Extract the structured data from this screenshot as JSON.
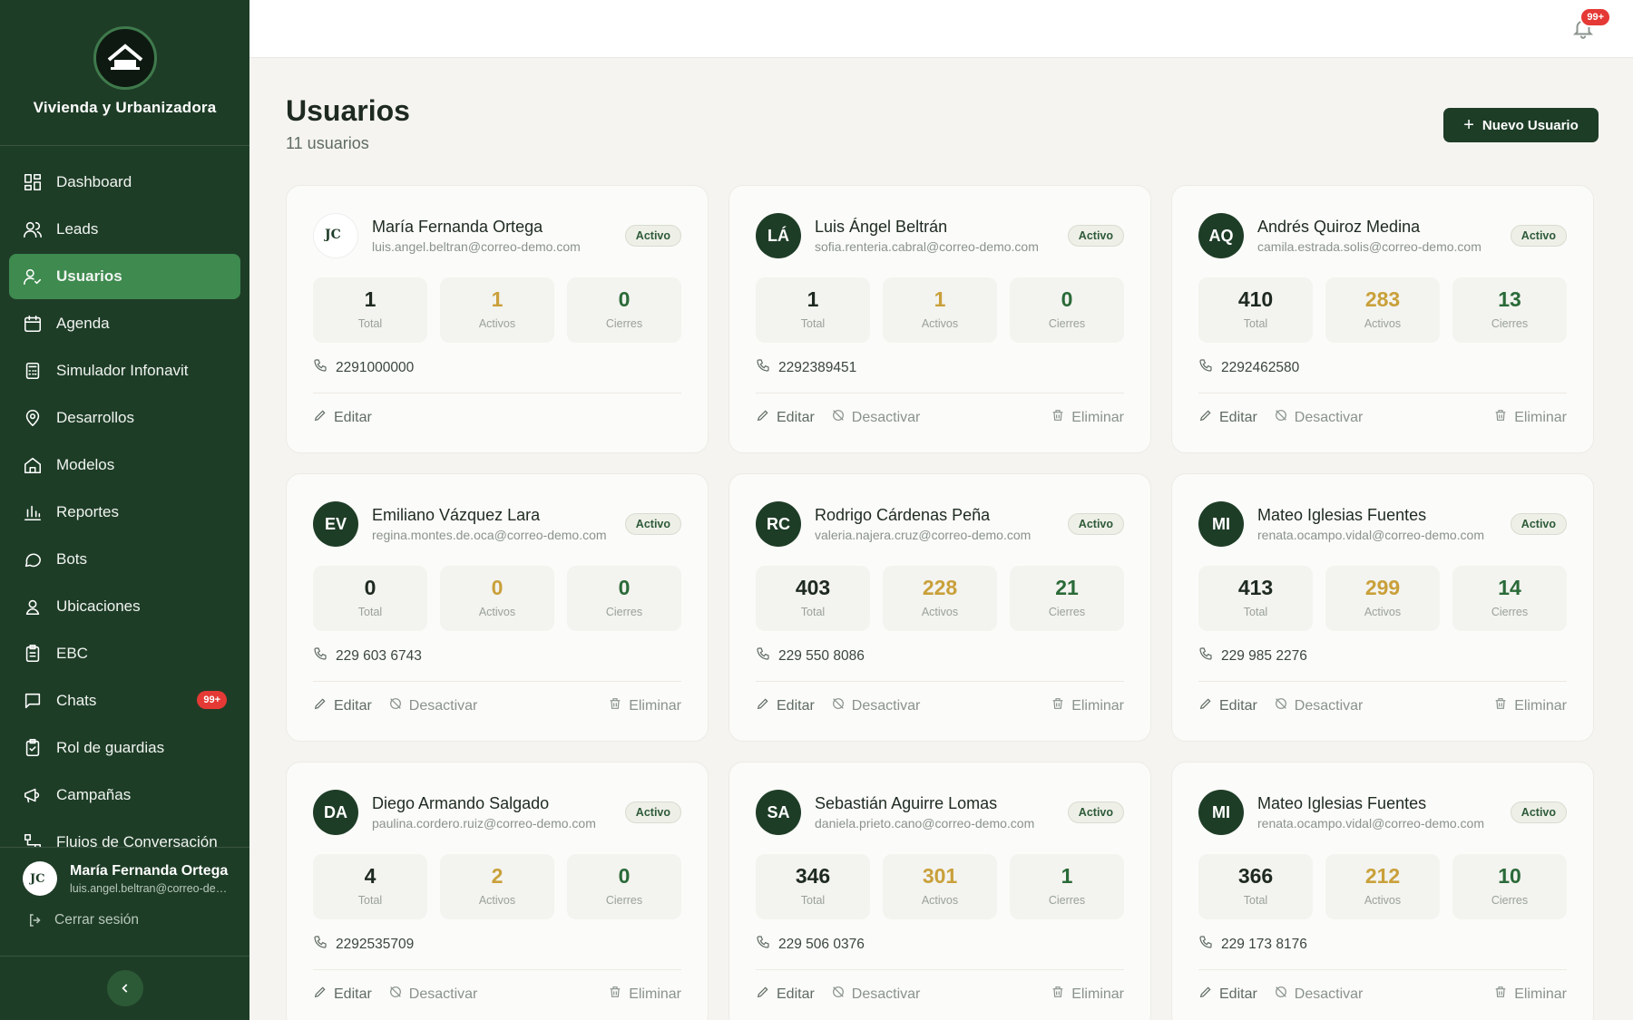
{
  "brand": {
    "name": "Vivienda y Urbanizadora"
  },
  "nav": {
    "items": [
      {
        "label": "Dashboard",
        "icon": "dashboard-icon"
      },
      {
        "label": "Leads",
        "icon": "users-icon"
      },
      {
        "label": "Usuarios",
        "icon": "user-check-icon",
        "active": true
      },
      {
        "label": "Agenda",
        "icon": "calendar-icon"
      },
      {
        "label": "Simulador Infonavit",
        "icon": "calculator-icon"
      },
      {
        "label": "Desarrollos",
        "icon": "map-pin-icon"
      },
      {
        "label": "Modelos",
        "icon": "home-icon"
      },
      {
        "label": "Reportes",
        "icon": "bar-chart-icon"
      },
      {
        "label": "Bots",
        "icon": "chat-bubble-icon"
      },
      {
        "label": "Ubicaciones",
        "icon": "location-user-icon"
      },
      {
        "label": "EBC",
        "icon": "clipboard-icon"
      },
      {
        "label": "Chats",
        "icon": "message-square-icon",
        "badge": "99+"
      },
      {
        "label": "Rol de guardias",
        "icon": "clipboard-check-icon"
      },
      {
        "label": "Campañas",
        "icon": "megaphone-icon"
      },
      {
        "label": "Flujos de Conversación",
        "icon": "flow-icon"
      }
    ]
  },
  "current_user": {
    "name": "María Fernanda Ortega",
    "email": "luis.angel.beltran@correo-demo.com"
  },
  "logout_label": "Cerrar sesión",
  "topbar": {
    "notification_count": "99+"
  },
  "page": {
    "title": "Usuarios",
    "subtitle": "11 usuarios",
    "new_button": "Nuevo Usuario"
  },
  "labels": {
    "total": "Total",
    "activos": "Activos",
    "cierres": "Cierres",
    "edit": "Editar",
    "deactivate": "Desactivar",
    "delete": "Eliminar"
  },
  "colors": {
    "sidebar": "#1e3d27",
    "active": "#3e8a4f",
    "gold": "#c9a03a",
    "danger": "#e53935"
  },
  "users": [
    {
      "initials": "",
      "logo": true,
      "name": "María Fernanda Ortega",
      "email": "luis.angel.beltran@correo-demo.com",
      "status": "Activo",
      "total": "1",
      "activos": "1",
      "cierres": "0",
      "phone": "2291000000",
      "can_manage": false
    },
    {
      "initials": "LÁ",
      "name": "Luis Ángel Beltrán",
      "email": "sofia.renteria.cabral@correo-demo.com",
      "status": "Activo",
      "total": "1",
      "activos": "1",
      "cierres": "0",
      "phone": "2292389451",
      "can_manage": true
    },
    {
      "initials": "AQ",
      "name": "Andrés Quiroz Medina",
      "email": "camila.estrada.solis@correo-demo.com",
      "status": "Activo",
      "total": "410",
      "activos": "283",
      "cierres": "13",
      "phone": "2292462580",
      "can_manage": true
    },
    {
      "initials": "EV",
      "name": "Emiliano Vázquez Lara",
      "email": "regina.montes.de.oca@correo-demo.com",
      "status": "Activo",
      "total": "0",
      "activos": "0",
      "cierres": "0",
      "phone": "229 603 6743",
      "can_manage": true
    },
    {
      "initials": "RC",
      "name": "Rodrigo Cárdenas Peña",
      "email": "valeria.najera.cruz@correo-demo.com",
      "status": "Activo",
      "total": "403",
      "activos": "228",
      "cierres": "21",
      "phone": "229 550 8086",
      "can_manage": true
    },
    {
      "initials": "MI",
      "name": "Mateo Iglesias Fuentes",
      "email": "renata.ocampo.vidal@correo-demo.com",
      "status": "Activo",
      "total": "413",
      "activos": "299",
      "cierres": "14",
      "phone": "229 985 2276",
      "can_manage": true
    },
    {
      "initials": "DA",
      "name": "Diego Armando Salgado",
      "email": "paulina.cordero.ruiz@correo-demo.com",
      "status": "Activo",
      "total": "4",
      "activos": "2",
      "cierres": "0",
      "phone": "2292535709",
      "can_manage": true
    },
    {
      "initials": "SA",
      "name": "Sebastián Aguirre Lomas",
      "email": "daniela.prieto.cano@correo-demo.com",
      "status": "Activo",
      "total": "346",
      "activos": "301",
      "cierres": "1",
      "phone": "229 506 0376",
      "can_manage": true
    },
    {
      "initials": "MI",
      "name": "Mateo Iglesias Fuentes",
      "email": "renata.ocampo.vidal@correo-demo.com",
      "status": "Activo",
      "total": "366",
      "activos": "212",
      "cierres": "10",
      "phone": "229 173 8176",
      "can_manage": true
    }
  ]
}
